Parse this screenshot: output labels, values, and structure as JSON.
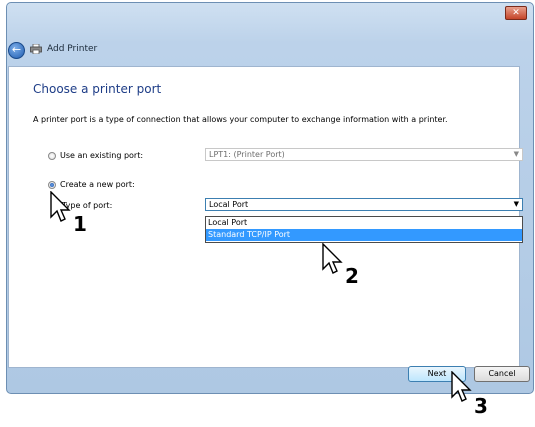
{
  "window": {
    "title": "Add Printer",
    "close_label": "✕"
  },
  "page": {
    "heading": "Choose a printer port",
    "description": "A printer port is a type of connection that allows your computer to exchange information with a printer."
  },
  "options": {
    "existing_label": "Use an existing port:",
    "existing_value": "LPT1: (Printer Port)",
    "create_label": "Create a new port:",
    "type_label": "Type of port:",
    "type_value": "Local Port"
  },
  "dropdown": {
    "items": [
      "Local Port",
      "Standard TCP/IP Port"
    ],
    "selected_index": 1
  },
  "buttons": {
    "next": "Next",
    "cancel": "Cancel"
  },
  "annotations": {
    "step1": "1",
    "step2": "2",
    "step3": "3"
  }
}
